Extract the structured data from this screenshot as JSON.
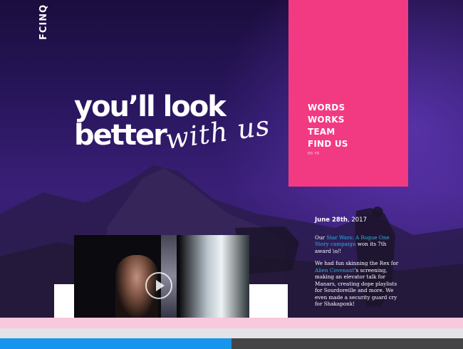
{
  "brand": {
    "logo_text": "FCINQ"
  },
  "hero": {
    "headline_line1": "you’ll look",
    "headline_line2": "better",
    "headline_script": "with us"
  },
  "nav": {
    "items": [
      "WORDS",
      "WORKS",
      "TEAM",
      "FIND US"
    ],
    "languages": [
      "EN",
      "FR"
    ]
  },
  "news": {
    "date_bold": "June 28th",
    "date_year": ", 2017",
    "p1_pre": "Our ",
    "p1_link": "Star Wars: A Rogue One Story campaign",
    "p1_post": " won its 7th award \\o/!",
    "p2_pre": "We had fun skinning the Rex for ",
    "p2_link": "Alien Covenant",
    "p2_post": "'s screening, making an elevator talk for Manars, creating dope playlists for Sourdoreille and more. We even made a security guard cry for Shakaponk!"
  },
  "video": {
    "play_icon": "play-icon"
  },
  "progress": {
    "value": 0.5
  },
  "colors": {
    "accent_pink": "#f23a82",
    "link_blue": "#2ab3e8",
    "progress_blue": "#1794ec"
  }
}
